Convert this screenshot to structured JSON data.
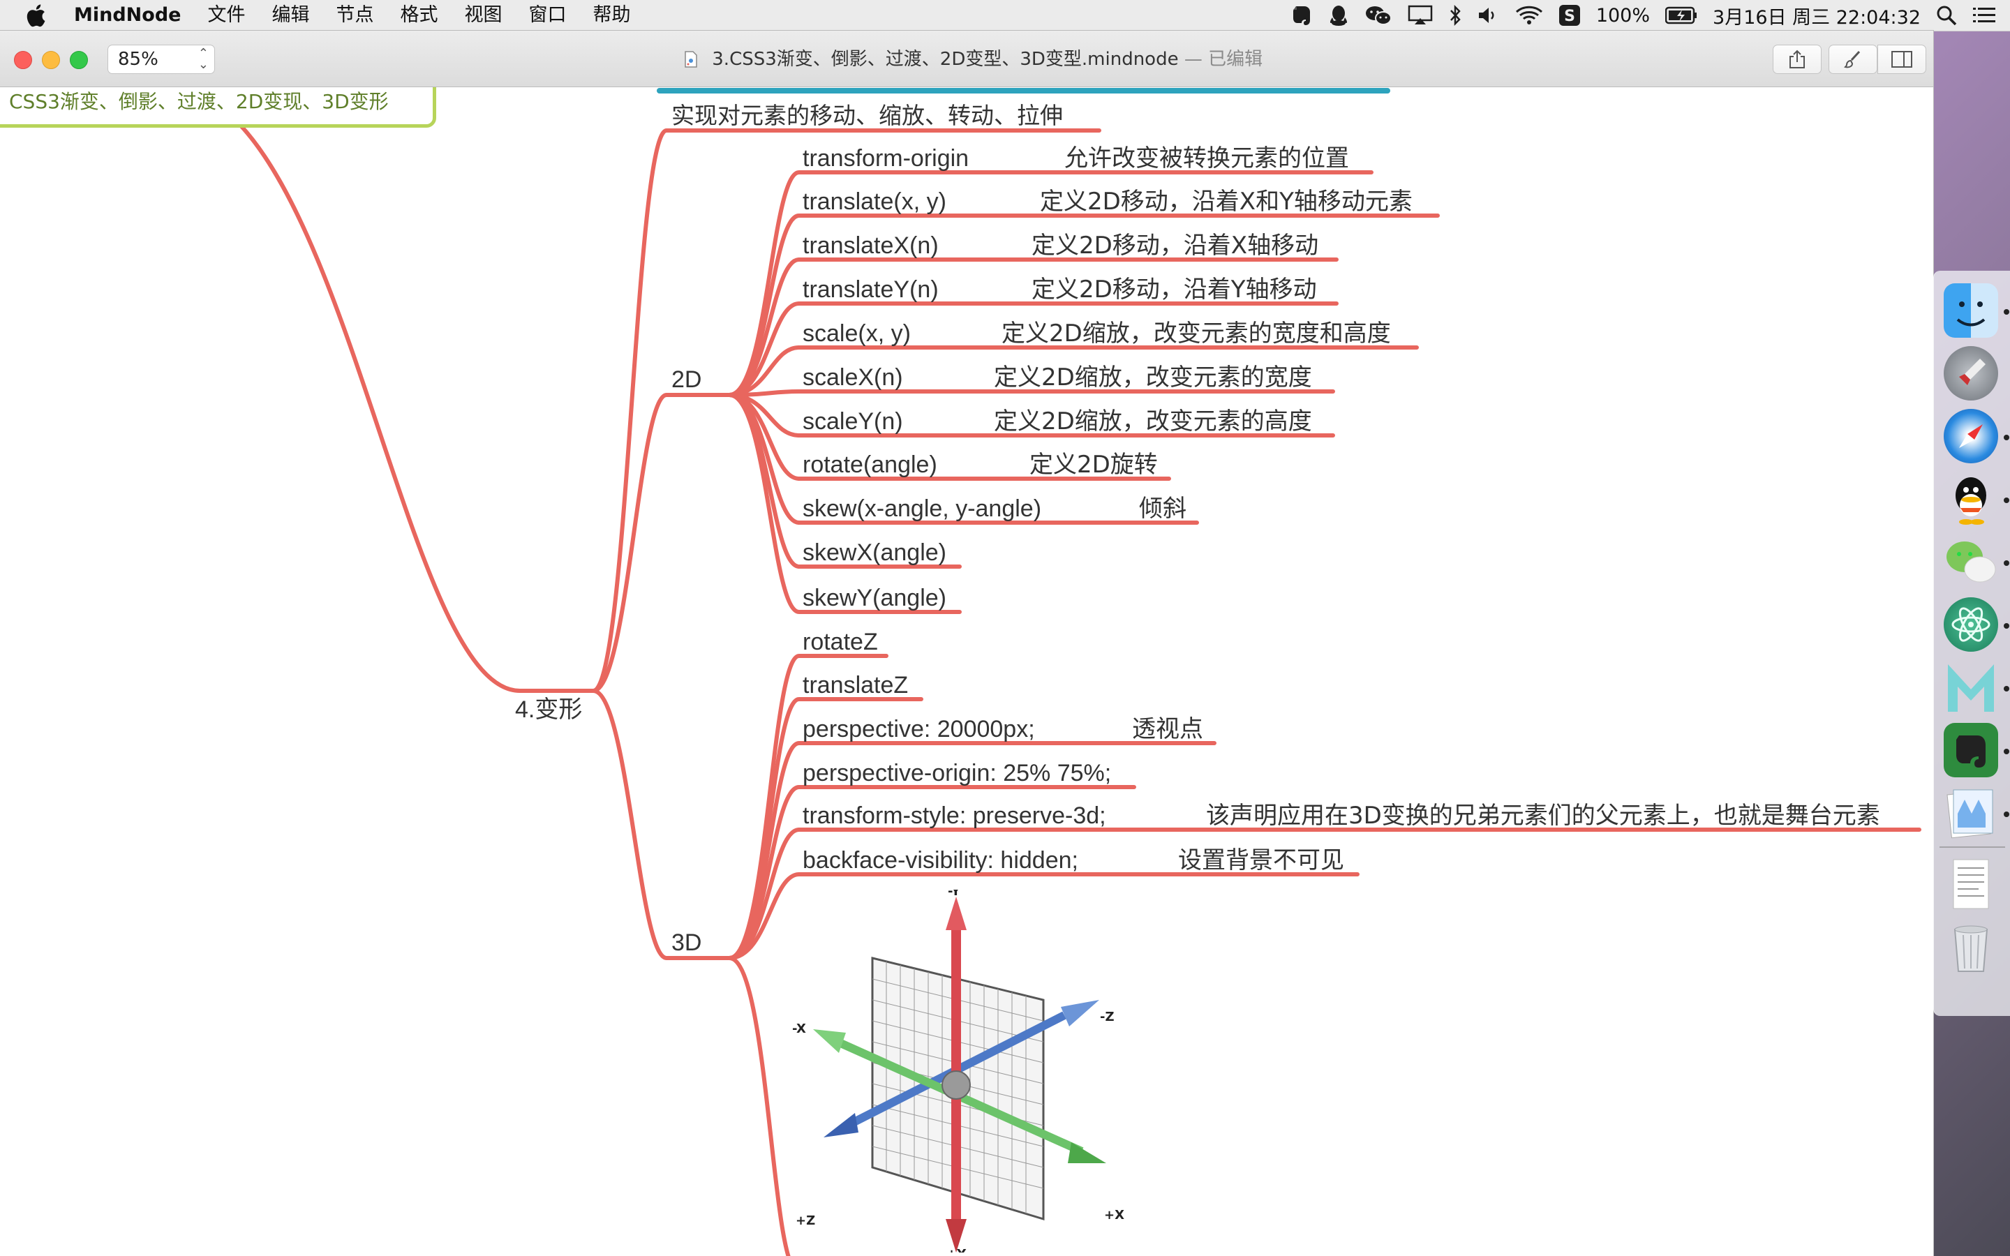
{
  "menubar": {
    "app_name": "MindNode",
    "menus": [
      "文件",
      "编辑",
      "节点",
      "格式",
      "视图",
      "窗口",
      "帮助"
    ],
    "battery": "100%",
    "datetime": "3月16日 周三  22:04:32",
    "status_icons": [
      "evernote-icon",
      "qq-icon",
      "wechat-icon",
      "airplay-icon",
      "bluetooth-icon",
      "volume-icon",
      "wifi-icon",
      "s-icon",
      "battery-icon",
      "search-icon",
      "list-icon"
    ]
  },
  "toolbar": {
    "zoom": "85%",
    "document_title": "3.CSS3渐变、倒影、过渡、2D变型、3D变型.mindnode",
    "edited_status": "— 已编辑",
    "buttons": [
      "share-button",
      "style-button",
      "sidebar-button"
    ]
  },
  "mindmap": {
    "root": "CSS3渐变、倒影、过渡、2D变现、3D变形",
    "branch": "4.变形",
    "intro": "实现对元素的移动、缩放、转动、拉伸",
    "sub2d": "2D",
    "sub3d": "3D",
    "items2d": [
      {
        "term": "transform-origin",
        "note": "允许改变被转换元素的位置"
      },
      {
        "term": "translate(x, y)",
        "note": "定义2D移动，沿着X和Y轴移动元素"
      },
      {
        "term": "translateX(n)",
        "note": "定义2D移动，沿着X轴移动"
      },
      {
        "term": "translateY(n)",
        "note": "定义2D移动，沿着Y轴移动"
      },
      {
        "term": "scale(x, y)",
        "note": "定义2D缩放，改变元素的宽度和高度"
      },
      {
        "term": "scaleX(n)",
        "note": "定义2D缩放，改变元素的宽度"
      },
      {
        "term": "scaleY(n)",
        "note": "定义2D缩放，改变元素的高度"
      },
      {
        "term": "rotate(angle)",
        "note": "定义2D旋转"
      },
      {
        "term": "skew(x-angle, y-angle)",
        "note": "倾斜"
      },
      {
        "term": "skewX(angle)",
        "note": ""
      },
      {
        "term": "skewY(angle)",
        "note": ""
      }
    ],
    "items3d": [
      {
        "term": "rotateZ",
        "note": ""
      },
      {
        "term": "translateZ",
        "note": ""
      },
      {
        "term": "perspective: 20000px;",
        "note": "透视点"
      },
      {
        "term": "perspective-origin: 25% 75%;",
        "note": ""
      },
      {
        "term": "transform-style: preserve-3d;",
        "note": "该声明应用在3D变换的兄弟元素们的父元素上，也就是舞台元素"
      },
      {
        "term": "backface-visibility: hidden;",
        "note": "设置背景不可见"
      }
    ],
    "axis_labels": {
      "neg_y": "-Y",
      "pos_y": "+Y",
      "neg_x": "-X",
      "pos_x": "+X",
      "neg_z": "-Z",
      "pos_z": "+Z"
    },
    "branch_color": "#e8665e",
    "root_border_color": "#b7d45a"
  },
  "dock": {
    "apps": [
      "finder-icon",
      "launchpad-icon",
      "safari-icon",
      "qq-icon",
      "wechat-icon",
      "atom-icon",
      "mindnode-m-icon",
      "evernote-icon",
      "preview-icon",
      "document-icon",
      "trash-icon"
    ]
  }
}
